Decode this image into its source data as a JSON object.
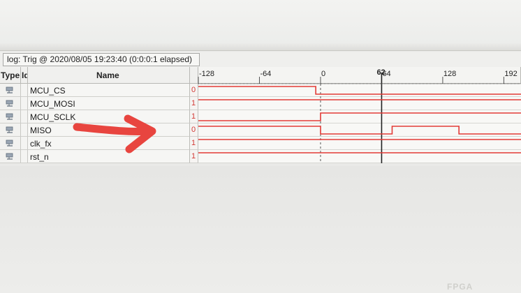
{
  "log": {
    "text": "log: Trig @ 2020/08/05 19:23:40 (0:0:0:1 elapsed)"
  },
  "columns": {
    "type": "Type",
    "id": "Id",
    "name": "Name"
  },
  "timeline": {
    "cursor_label": "62",
    "ticks": [
      {
        "label": "-128",
        "value": -128
      },
      {
        "label": "-64",
        "value": -64
      },
      {
        "label": "0",
        "value": 0
      },
      {
        "label": "64",
        "value": 64
      },
      {
        "label": "128",
        "value": 128
      },
      {
        "label": "192",
        "value": 192
      }
    ],
    "range": [
      -128,
      210
    ],
    "cursor_value": 64
  },
  "signals": [
    {
      "name": "MCU_CS",
      "value": "0",
      "transitions": [
        [
          -128,
          1
        ],
        [
          -5,
          0
        ],
        [
          210,
          0
        ]
      ]
    },
    {
      "name": "MCU_MOSI",
      "value": "1",
      "transitions": [
        [
          -128,
          1
        ],
        [
          210,
          1
        ]
      ]
    },
    {
      "name": "MCU_SCLK",
      "value": "1",
      "transitions": [
        [
          -128,
          0
        ],
        [
          0,
          1
        ],
        [
          210,
          1
        ]
      ]
    },
    {
      "name": "MISO",
      "value": "0",
      "transitions": [
        [
          -128,
          1
        ],
        [
          0,
          0
        ],
        [
          75,
          1
        ],
        [
          145,
          0
        ],
        [
          210,
          0
        ]
      ]
    },
    {
      "name": "clk_fx",
      "value": "1",
      "transitions": [
        [
          -128,
          1
        ],
        [
          210,
          1
        ]
      ]
    },
    {
      "name": "rst_n",
      "value": "1",
      "transitions": [
        [
          -128,
          1
        ],
        [
          210,
          1
        ]
      ]
    }
  ],
  "colors": {
    "wave": "#e23a36",
    "cursor": "#222222",
    "arrow": "#e8453f"
  },
  "watermark": "FPGA"
}
